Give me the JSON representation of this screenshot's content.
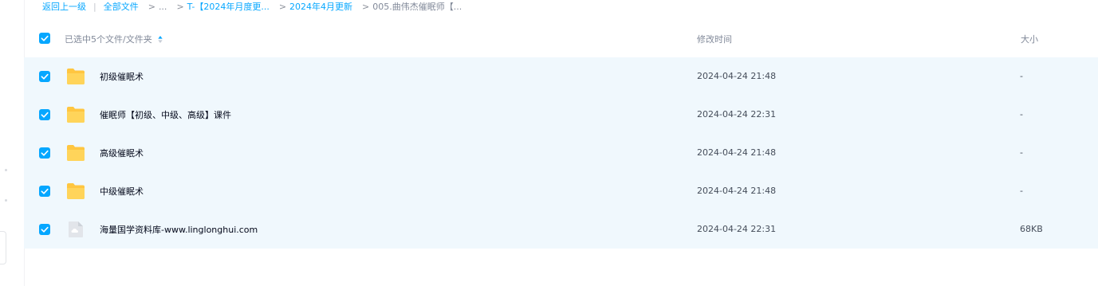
{
  "breadcrumb": {
    "back": "返回上一级",
    "all_files": "全部文件",
    "ellipsis": "...",
    "crumb1": "T-【2024年月度更...",
    "crumb2": "2024年4月更新",
    "current": "005.曲伟杰催眠师【...",
    "separator": ">"
  },
  "header": {
    "selection_text": "已选中5个文件/文件夹",
    "col_time": "修改时间",
    "col_size": "大小"
  },
  "files": [
    {
      "name": "初级催眠术",
      "type": "folder",
      "modified": "2024-04-24 21:48",
      "size": "-",
      "checked": true
    },
    {
      "name": "催眠师【初级、中级、高级】课件",
      "type": "folder",
      "modified": "2024-04-24 22:31",
      "size": "-",
      "checked": true
    },
    {
      "name": "高级催眠术",
      "type": "folder",
      "modified": "2024-04-24 21:48",
      "size": "-",
      "checked": true
    },
    {
      "name": "中级催眠术",
      "type": "folder",
      "modified": "2024-04-24 21:48",
      "size": "-",
      "checked": true
    },
    {
      "name": "海量国学资料库-www.linglonghui.com",
      "type": "file",
      "modified": "2024-04-24 22:31",
      "size": "68KB",
      "checked": true
    }
  ],
  "colors": {
    "accent": "#06a7ff",
    "selected_row": "#f0f8fd",
    "folder": "#ffc640",
    "muted_text": "#818999"
  }
}
